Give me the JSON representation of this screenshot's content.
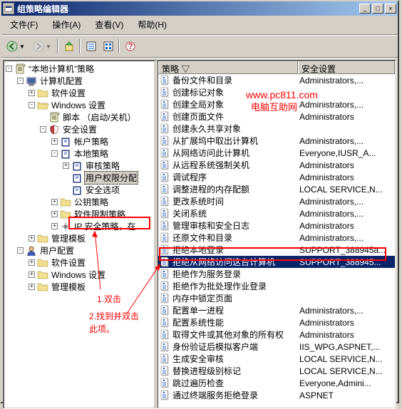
{
  "window": {
    "title": "组策略编辑器"
  },
  "menu": {
    "file": "文件(F)",
    "action": "操作(A)",
    "view": "查看(V)",
    "help": "帮助(H)"
  },
  "tree": {
    "root": "“本地计算机”策略",
    "computer_config": "计算机配置",
    "software_settings": "软件设置",
    "windows_settings": "Windows 设置",
    "scripts": "脚本 （启动/关机）",
    "security_settings": "安全设置",
    "account_policy": "帐户策略",
    "local_policy": "本地策略",
    "audit_policy": "审核策略",
    "user_rights": "用户权限分配",
    "security_options": "安全选项",
    "public_key": "公钥策略",
    "software_restrict": "软件限制策略",
    "ip_security": "IP 安全策略，在 ",
    "admin_templates": "管理模板",
    "user_config": "用户配置",
    "software_settings2": "软件设置",
    "windows_settings2": "Windows 设置",
    "admin_templates2": "管理模板"
  },
  "list": {
    "col_policy": "策略  ▽",
    "col_security": "安全设置"
  },
  "policies": [
    {
      "name": "备份文件和目录",
      "setting": "Administrators,..."
    },
    {
      "name": "创建标记对象",
      "setting": ""
    },
    {
      "name": "创建全局对象",
      "setting": "Administrators,..."
    },
    {
      "name": "创建页面文件",
      "setting": "Administrators"
    },
    {
      "name": "创建永久共享对象",
      "setting": ""
    },
    {
      "name": "从扩展坞中取出计算机",
      "setting": "Administrators,..."
    },
    {
      "name": "从网络访问此计算机",
      "setting": "Everyone,IUSR_A..."
    },
    {
      "name": "从远程系统强制关机",
      "setting": "Administrators"
    },
    {
      "name": "调试程序",
      "setting": "Administrators"
    },
    {
      "name": "调整进程的内存配额",
      "setting": "LOCAL SERVICE,N..."
    },
    {
      "name": "更改系统时间",
      "setting": "Administrators,..."
    },
    {
      "name": "关闭系统",
      "setting": "Administrators,..."
    },
    {
      "name": "管理审核和安全日志",
      "setting": "Administrators"
    },
    {
      "name": "还原文件和目录",
      "setting": "Administrators,..."
    },
    {
      "name": "拒绝本地登录",
      "setting": "SUPPORT_388945a..."
    },
    {
      "name": "拒绝从网络访问这台计算机",
      "setting": "SUPPORT_388945...",
      "selected": true
    },
    {
      "name": "拒绝作为服务登录",
      "setting": ""
    },
    {
      "name": "拒绝作为批处理作业登录",
      "setting": ""
    },
    {
      "name": "内存中锁定页面",
      "setting": ""
    },
    {
      "name": "配置单一进程",
      "setting": "Administrators,..."
    },
    {
      "name": "配置系统性能",
      "setting": "Administrators"
    },
    {
      "name": "取得文件或其他对象的所有权",
      "setting": "Administrators"
    },
    {
      "name": "身份验证后模拟客户端",
      "setting": "IIS_WPG,ASPNET,..."
    },
    {
      "name": "生成安全审核",
      "setting": "LOCAL SERVICE,N..."
    },
    {
      "name": "替换进程级别标记",
      "setting": "LOCAL SERVICE,N..."
    },
    {
      "name": "跳过遍历检查",
      "setting": "Everyone,Admini..."
    },
    {
      "name": "通过终端服务拒绝登录",
      "setting": "ASPNET"
    }
  ],
  "annotations": {
    "step1": "1.双击",
    "step2": "2.找到并双击此项。",
    "watermark_url": "www.pc811.com",
    "watermark_text": "电脑互助网"
  }
}
